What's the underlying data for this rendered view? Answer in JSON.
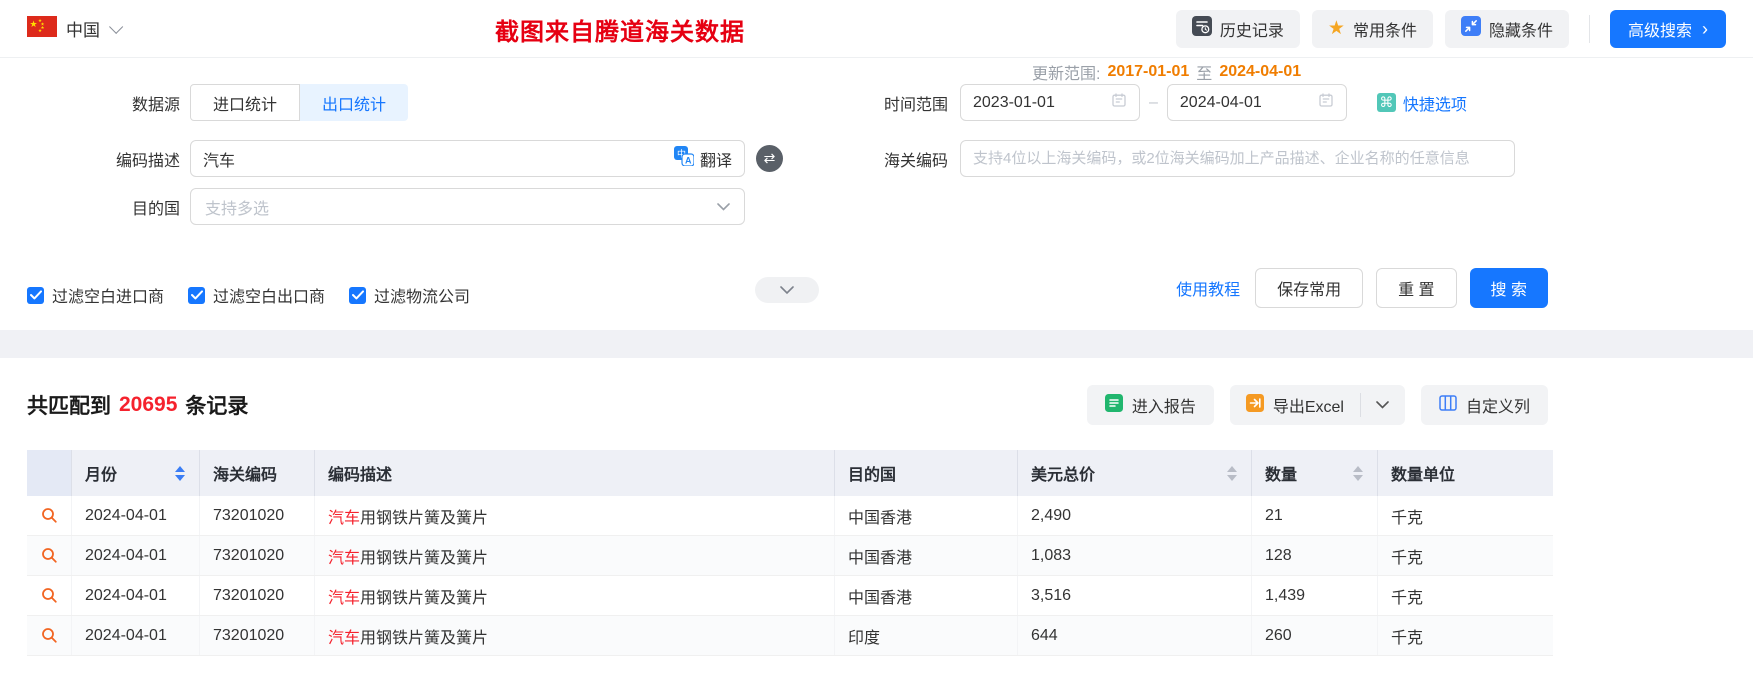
{
  "topbar": {
    "country": "中国",
    "watermark_title": "截图来自腾道海关数据",
    "history_button": "历史记录",
    "favorites_button": "常用条件",
    "hide_conditions_button": "隐藏条件",
    "advanced_search_button": "高级搜索",
    "advanced_search_arrow": "›"
  },
  "form": {
    "data_source": {
      "label": "数据源",
      "tabs": [
        {
          "label": "进口统计",
          "active": false
        },
        {
          "label": "出口统计",
          "active": true
        }
      ]
    },
    "update_range": {
      "label": "更新范围:",
      "start": "2017-01-01",
      "to": "至",
      "end": "2024-04-01"
    },
    "time_range": {
      "label": "时间范围",
      "start": "2023-01-01",
      "separator": "–",
      "end": "2024-04-01",
      "quick_options": "快捷选项",
      "cmd_glyph": "⌘"
    },
    "code_desc": {
      "label": "编码描述",
      "value": "汽车",
      "translate_label": "翻译",
      "swap_glyph": "⇄"
    },
    "customs_code": {
      "label": "海关编码",
      "placeholder": "支持4位以上海关编码，或2位海关编码加上产品描述、企业名称的任意信息"
    },
    "dest_country": {
      "label": "目的国",
      "placeholder": "支持多选"
    },
    "filters": [
      {
        "label": "过滤空白进口商",
        "checked": true
      },
      {
        "label": "过滤空白出口商",
        "checked": true
      },
      {
        "label": "过滤物流公司",
        "checked": true
      }
    ],
    "tutorial_link": "使用教程",
    "save_button": "保存常用",
    "reset_button": "重 置",
    "search_button": "搜 索"
  },
  "results": {
    "summary_prefix": "共匹配到",
    "count": "20695",
    "summary_suffix": "条记录",
    "report_button": "进入报告",
    "export_button": "导出Excel",
    "custom_columns_button": "自定义列"
  },
  "table": {
    "columns": [
      {
        "label": "月份",
        "sortable": true
      },
      {
        "label": "海关编码",
        "sortable": false
      },
      {
        "label": "编码描述",
        "sortable": false
      },
      {
        "label": "目的国",
        "sortable": false
      },
      {
        "label": "美元总价",
        "sortable": true
      },
      {
        "label": "数量",
        "sortable": true
      },
      {
        "label": "数量单位",
        "sortable": false
      }
    ],
    "rows": [
      {
        "month": "2024-04-01",
        "hs_code": "73201020",
        "desc_highlight": "汽车",
        "desc_rest": "用钢铁片簧及簧片",
        "dest": "中国香港",
        "usd_total": "2,490",
        "quantity": "21",
        "unit": "千克"
      },
      {
        "month": "2024-04-01",
        "hs_code": "73201020",
        "desc_highlight": "汽车",
        "desc_rest": "用钢铁片簧及簧片",
        "dest": "中国香港",
        "usd_total": "1,083",
        "quantity": "128",
        "unit": "千克"
      },
      {
        "month": "2024-04-01",
        "hs_code": "73201020",
        "desc_highlight": "汽车",
        "desc_rest": "用钢铁片簧及簧片",
        "dest": "中国香港",
        "usd_total": "3,516",
        "quantity": "1,439",
        "unit": "千克"
      },
      {
        "month": "2024-04-01",
        "hs_code": "73201020",
        "desc_highlight": "汽车",
        "desc_rest": "用钢铁片簧及簧片",
        "dest": "印度",
        "usd_total": "644",
        "quantity": "260",
        "unit": "千克"
      }
    ]
  },
  "colors": {
    "accent_blue": "#1677ff",
    "tab_active_bg": "#e8f3ff",
    "watermark_red": "#e60012",
    "count_red": "#f5222d",
    "keyword_red": "#f5222d",
    "update_orange": "#f07d00",
    "star_gold": "#f5a623",
    "cmd_teal": "#52c7b8",
    "report_green": "#21b66e",
    "export_orange": "#f59a23",
    "magnifier_orange": "#f26522",
    "table_header_bg": "#eef0f6"
  }
}
